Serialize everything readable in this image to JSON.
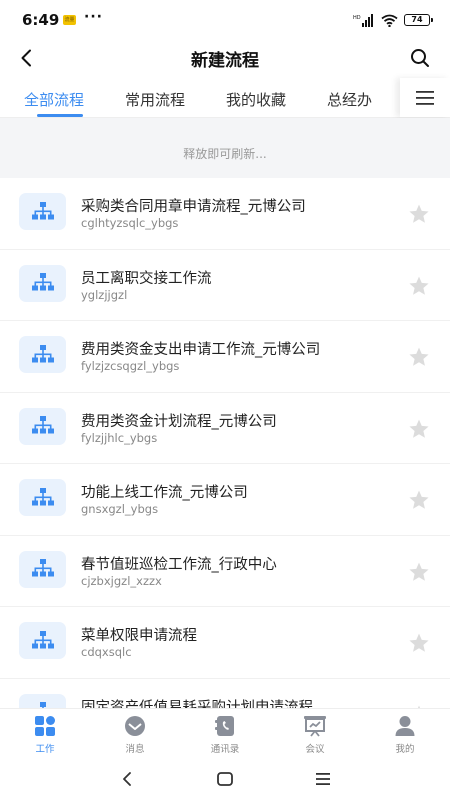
{
  "status_bar": {
    "time": "6:49",
    "app_badge": "流量",
    "dots": "···",
    "signal_tag": "HD",
    "battery": "74"
  },
  "header": {
    "title": "新建流程"
  },
  "tabs": [
    {
      "label": "全部流程",
      "active": true
    },
    {
      "label": "常用流程",
      "active": false
    },
    {
      "label": "我的收藏",
      "active": false
    },
    {
      "label": "总经办",
      "active": false
    }
  ],
  "refresh": {
    "text": "释放即可刷新..."
  },
  "flows": [
    {
      "title": "采购类合同用章申请流程_元博公司",
      "code": "cglhtyzsqlc_ybgs"
    },
    {
      "title": "员工离职交接工作流",
      "code": "yglzjjgzl"
    },
    {
      "title": "费用类资金支出申请工作流_元博公司",
      "code": "fylzjzcsqgzl_ybgs"
    },
    {
      "title": "费用类资金计划流程_元博公司",
      "code": "fylzjjhlc_ybgs"
    },
    {
      "title": "功能上线工作流_元博公司",
      "code": "gnsxgzl_ybgs"
    },
    {
      "title": "春节值班巡检工作流_行政中心",
      "code": "cjzbxjgzl_xzzx"
    },
    {
      "title": "菜单权限申请流程",
      "code": "cdqxsqlc"
    },
    {
      "title": "固定资产低值易耗采购计划申请流程…",
      "code": ""
    }
  ],
  "bottom_nav": [
    {
      "label": "工作",
      "icon": "work-icon",
      "active": true
    },
    {
      "label": "消息",
      "icon": "message-icon",
      "active": false
    },
    {
      "label": "通讯录",
      "icon": "contacts-icon",
      "active": false
    },
    {
      "label": "会议",
      "icon": "meeting-icon",
      "active": false
    },
    {
      "label": "我的",
      "icon": "profile-icon",
      "active": false
    }
  ],
  "colors": {
    "accent": "#3c8cf0",
    "icon_bg": "#e9f2fd",
    "star": "#dcdcdc",
    "nav_inactive": "#8a8f99"
  }
}
